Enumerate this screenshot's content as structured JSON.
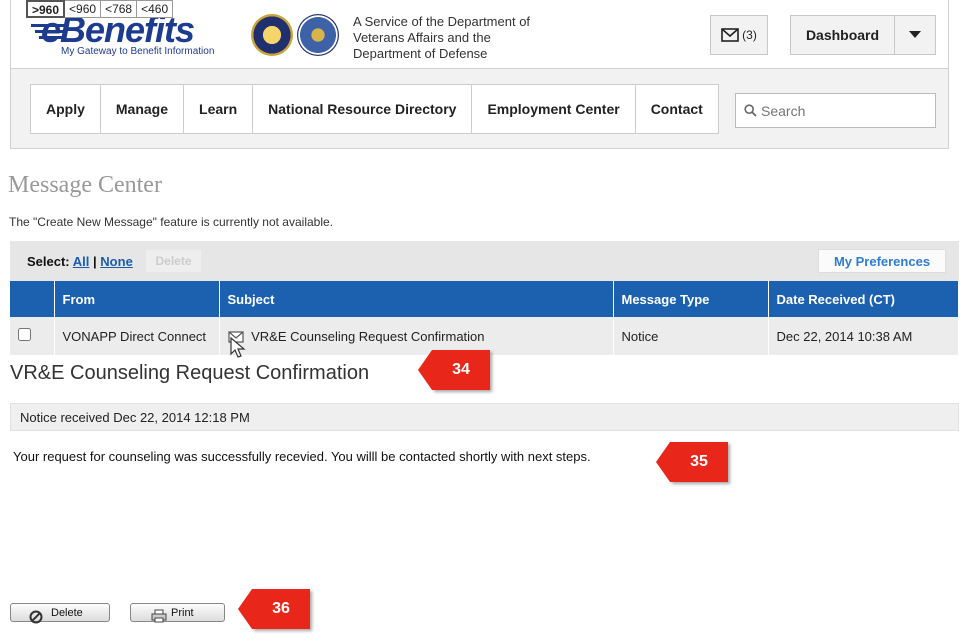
{
  "breakpoints": [
    ">960",
    "<960",
    "<768",
    "<460"
  ],
  "header": {
    "logo_word": "eBenefits",
    "logo_tagline": "My Gateway to Benefit Information",
    "service_line1": "A Service of the Department of",
    "service_line2": "Veterans Affairs and the",
    "service_line3": "Department of Defense",
    "message_count": "(3)",
    "dashboard_label": "Dashboard"
  },
  "nav": {
    "items": [
      "Apply",
      "Manage",
      "Learn",
      "National Resource Directory",
      "Employment Center",
      "Contact"
    ],
    "search_placeholder": "Search"
  },
  "message_center": {
    "title": "Message Center",
    "note": "The \"Create New Message\" feature is currently not available.",
    "select_label": "Select:",
    "select_all": "All",
    "select_separator": "|",
    "select_none": "None",
    "delete_disabled": "Delete",
    "preferences": "My Preferences",
    "columns": [
      "From",
      "Subject",
      "Message Type",
      "Date Received (CT)"
    ],
    "rows": [
      {
        "from": "VONAPP Direct Connect",
        "subject": "VR&E Counseling Request Confirmation",
        "type": "Notice",
        "date": "Dec 22, 2014 10:38 AM"
      }
    ]
  },
  "message": {
    "title": "VR&E Counseling Request Confirmation",
    "received": "Notice received Dec 22, 2014 12:18 PM",
    "body": "Your request for counseling was successfully recevied.  You willl be contacted shortly with next steps."
  },
  "callouts": [
    "34",
    "35",
    "36"
  ],
  "actions": {
    "delete": "Delete",
    "print": "Print"
  },
  "colors": {
    "table_header": "#1b61b0",
    "callout": "#e8271a",
    "link": "#1a5cb0"
  }
}
